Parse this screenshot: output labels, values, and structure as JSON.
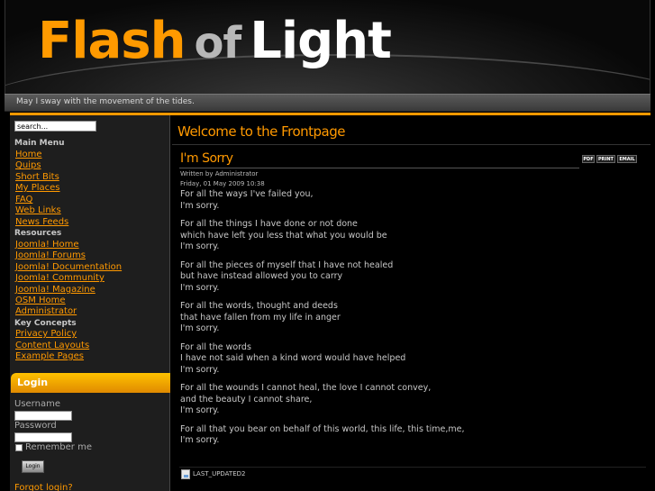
{
  "header": {
    "logo_word1": "Flash",
    "logo_word2": "of",
    "logo_word3": "Light",
    "slogan": "May I sway with the movement of the tides."
  },
  "sidebar": {
    "search_value": "search...",
    "main_menu_title": "Main Menu",
    "main_menu": [
      "Home",
      "Quips",
      "Short Bits",
      "My Places",
      "FAQ",
      "Web Links",
      "News Feeds"
    ],
    "resources_title": "Resources",
    "resources": [
      "Joomla! Home",
      "Joomla! Forums",
      "Joomla! Documentation",
      "Joomla! Community",
      "Joomla! Magazine",
      "OSM Home",
      "Administrator"
    ],
    "key_concepts_title": "Key Concepts",
    "key_concepts": [
      "Privacy Policy",
      "Content Layouts",
      "Example Pages"
    ]
  },
  "login": {
    "title": "Login",
    "username_label": "Username",
    "password_label": "Password",
    "remember_label": "Remember me",
    "button_label": "Login",
    "forgot_label": "Forgot login?"
  },
  "main": {
    "page_title": "Welcome to the Frontpage",
    "article": {
      "title": "I'm Sorry",
      "tools": [
        "PDF",
        "PRINT",
        "EMAIL"
      ],
      "author": "Written by Administrator",
      "date": "Friday, 01 May 2009 10:38",
      "stanzas": [
        [
          "For all the ways I've failed you,",
          "I'm sorry."
        ],
        [
          "For all the things I have done or not done",
          "which have left you less that what you would be",
          "I'm sorry."
        ],
        [
          "For all the pieces of myself that I have not healed",
          "but have instead allowed you to carry",
          "I'm sorry."
        ],
        [
          "For all the words, thought and deeds",
          "that have fallen from my life in anger",
          "I'm sorry."
        ],
        [
          "For all the words",
          "I have not said when a kind word would have helped",
          "I'm sorry."
        ],
        [
          "For all the wounds I cannot heal, the love I cannot convey,",
          "and the beauty I cannot share,",
          "I'm sorry."
        ],
        [
          "For all that you bear on behalf of this world, this life, this time,me,",
          "I'm sorry."
        ]
      ],
      "last_updated": "LAST_UPDATED2"
    }
  },
  "colors": {
    "accent": "#ff9900",
    "background": "#000000",
    "sidebar": "#1e1e1e"
  }
}
